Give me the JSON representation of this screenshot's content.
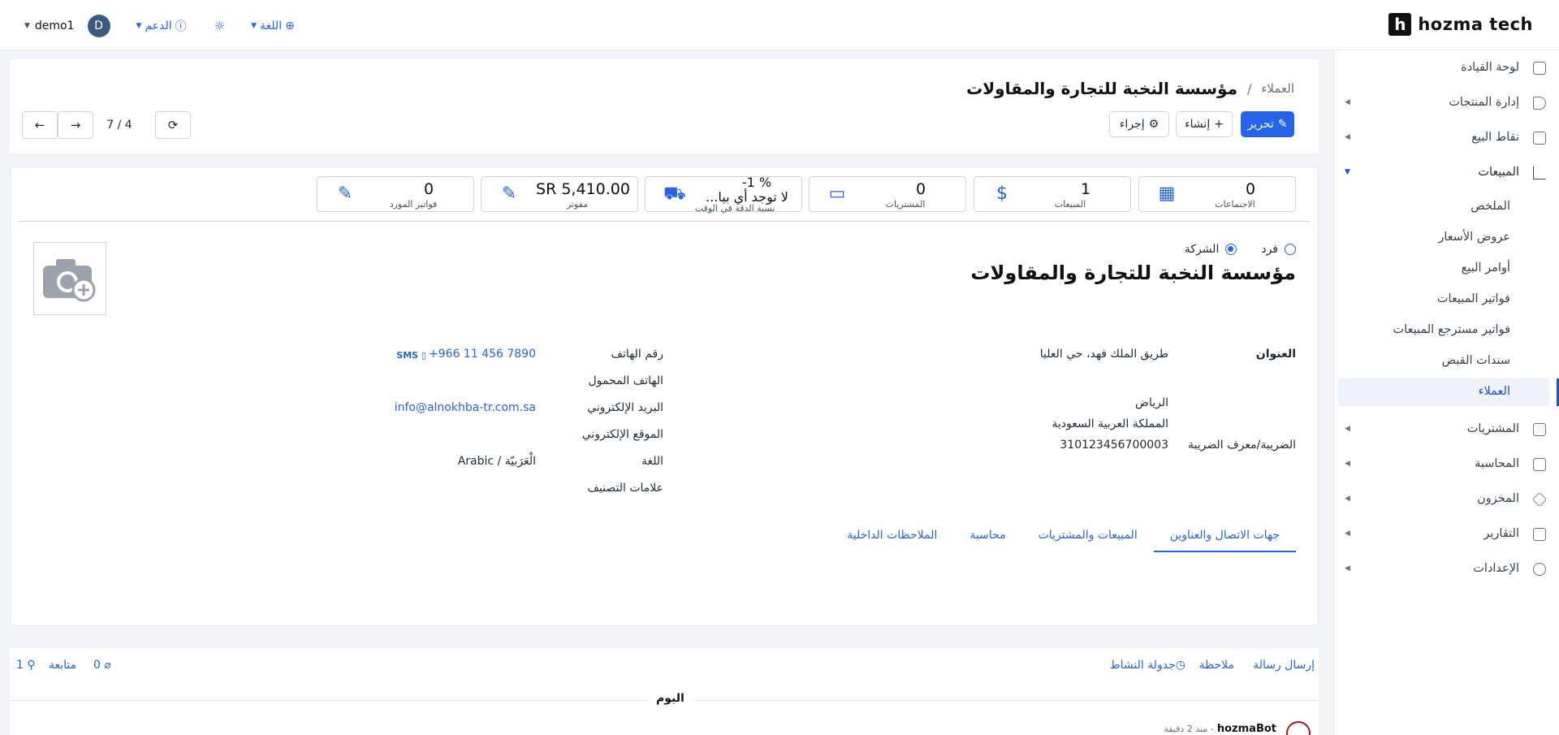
{
  "brand": {
    "logo_letter": "h",
    "name": "hozma tech"
  },
  "topbar": {
    "user": "demo1",
    "avatar_letter": "D",
    "support": "الدعم",
    "language": "اللغة"
  },
  "sidebar": {
    "items": [
      {
        "label": "لوحة القيادة",
        "icon": "dashboard-icon"
      },
      {
        "label": "إدارة المنتجات",
        "icon": "tag-icon"
      },
      {
        "label": "نقاط البيع",
        "icon": "store-icon"
      },
      {
        "label": "المبيعات",
        "icon": "chart-icon",
        "open": true
      },
      {
        "label": "المشتريات",
        "icon": "card-icon"
      },
      {
        "label": "المحاسبة",
        "icon": "ledger-icon"
      },
      {
        "label": "المخزون",
        "icon": "box-icon"
      },
      {
        "label": "التقارير",
        "icon": "report-icon"
      },
      {
        "label": "الإعدادات",
        "icon": "gear-icon"
      }
    ],
    "sales_sub": [
      "الملخص",
      "عروض الأسعار",
      "أوامر البيع",
      "فواتير المبيعات",
      "فواتير مسترجع المبيعات",
      "سندات القبض",
      "العملاء"
    ],
    "active_sub": "العملاء"
  },
  "header": {
    "breadcrumb_parent": "العملاء",
    "breadcrumb_separator": "/",
    "title": "مؤسسة النخبة للتجارة والمقاولات",
    "edit": "تحرير",
    "create": "إنشاء",
    "action": "إجراء",
    "pager": "7 / 4"
  },
  "stats": [
    {
      "value": "0",
      "label": "الاجتماعات",
      "icon": "calendar-icon"
    },
    {
      "value": "1",
      "label": "المبيعات",
      "icon": "dollar-icon"
    },
    {
      "value": "0",
      "label": "المشتريات",
      "icon": "credit-card-icon"
    },
    {
      "value": "-1 %",
      "value2": "لا توجد أي بيا...",
      "label": "نسبة الدقة في الوقت",
      "icon": "truck-icon"
    },
    {
      "value": "SR 5,410.00",
      "label": "مفوتر",
      "icon": "pencil-icon"
    },
    {
      "value": "0",
      "label": "فواتير المورد",
      "icon": "pencil-icon"
    }
  ],
  "form": {
    "type_individual": "فرد",
    "type_company": "الشركة",
    "name": "مؤسسة النخبة للتجارة والمقاولات",
    "address_label": "العنوان",
    "address_line1": "طريق الملك فهد، حي العليا",
    "city": "الرياض",
    "country": "المملكة العربية السعودية",
    "tax_label": "الضريبة/معرف الضريبة",
    "tax_value": "310123456700003",
    "phone_label": "رقم الهاتف",
    "phone_value": "+966 11 456 7890",
    "sms": "SMS",
    "mobile_label": "الهاتف المحمول",
    "email_label": "البريد الإلكتروني",
    "email_value": "info@alnokhba-tr.com.sa",
    "website_label": "الموقع الإلكتروني",
    "lang_label": "اللغة",
    "lang_value": "Arabic / الْعَرَبيّة",
    "tags_label": "علامات التصنيف"
  },
  "tabs": [
    "جهات الاتصال والعناوين",
    "المبيعات والمشتريات",
    "محاسبة",
    "الملاحظات الداخلية"
  ],
  "chatter": {
    "send_message": "إرسال رسالة",
    "note": "ملاحظة",
    "schedule": "جدولة النشاط",
    "attachments": "0",
    "follow": "متابعة",
    "followers": "1",
    "today": "اليوم",
    "bot_name": "hozmaBot",
    "bot_time": "- منذ 2 دقيقة"
  }
}
